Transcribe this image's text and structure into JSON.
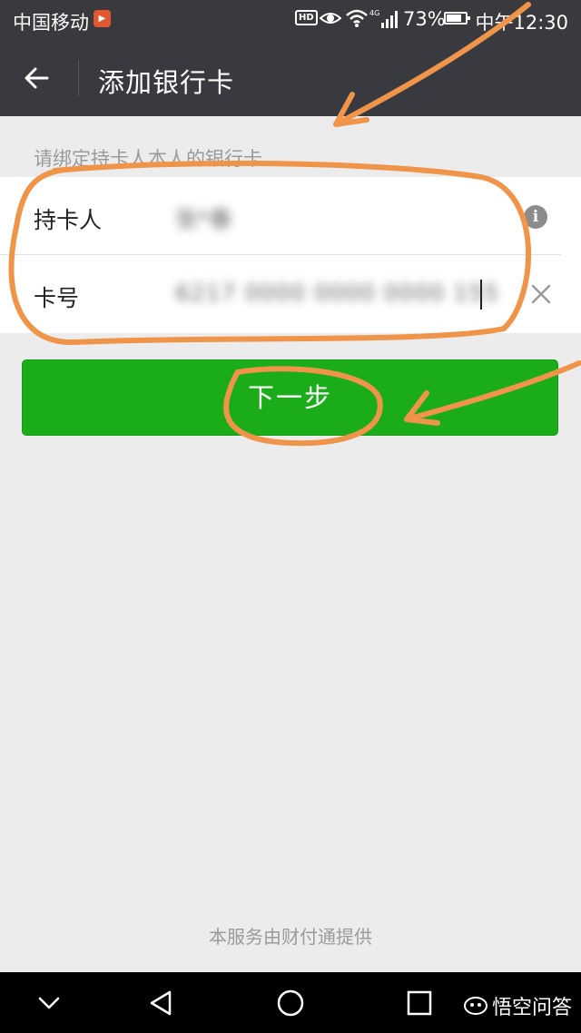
{
  "status_bar": {
    "carrier": "中国移动",
    "network": "4G",
    "battery": "73%",
    "time": "中午12:30",
    "hd_label": "HD"
  },
  "app_bar": {
    "back_icon": "arrow-left-icon",
    "title": "添加银行卡"
  },
  "form": {
    "hint": "请绑定持卡人本人的银行卡",
    "fields": [
      {
        "label": "持卡人",
        "value": "张*春",
        "icon": "info-icon"
      },
      {
        "label": "卡号",
        "value": "6217 0000 0000 0000 155",
        "icon": "clear-icon"
      }
    ]
  },
  "next_button": {
    "label": "下一步"
  },
  "footer": "本服务由财付通提供",
  "nav_bar": {
    "icons": [
      "chevron-down-icon",
      "back-triangle-icon",
      "home-circle-icon",
      "recents-square-icon"
    ],
    "watermark": "悟空问答"
  },
  "colors": {
    "status_bar_bg": "#3a3a3e",
    "app_bar_bg": "#393a3f",
    "page_bg": "#ececec",
    "button_green": "#1aad19",
    "annotation_orange": "#f0944a"
  }
}
